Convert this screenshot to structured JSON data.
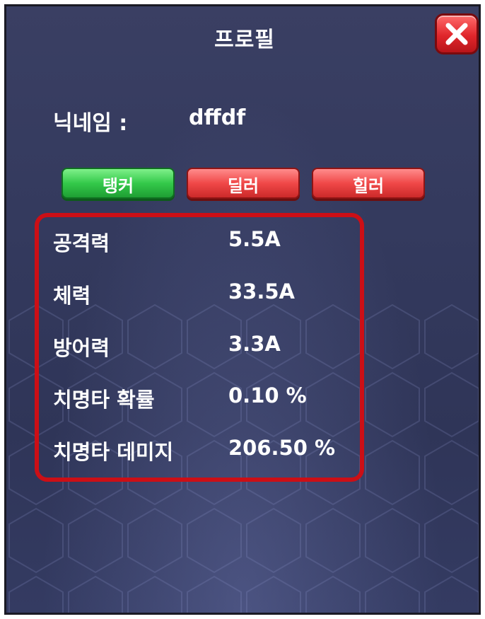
{
  "window": {
    "title": "프로필"
  },
  "profile": {
    "nickname_label": "닉네임 :",
    "nickname": "dffdf"
  },
  "tabs": [
    {
      "label": "탱커",
      "color": "#34c94a",
      "selected": true
    },
    {
      "label": "딜러",
      "color": "#f04848",
      "selected": false
    },
    {
      "label": "힐러",
      "color": "#f04848",
      "selected": false
    }
  ],
  "stats": [
    {
      "label": "공격력",
      "value": "5.5A"
    },
    {
      "label": "체력",
      "value": "33.5A"
    },
    {
      "label": "방어력",
      "value": "3.3A"
    },
    {
      "label": "치명타 확률",
      "value": "0.10 %"
    },
    {
      "label": "치명타 데미지",
      "value": "206.50 %"
    }
  ],
  "colors": {
    "highlight_border": "#cc0f16",
    "close_button": "#e0262b",
    "panel_bg": "#343a5e"
  },
  "icons": {
    "close": "close-icon"
  }
}
